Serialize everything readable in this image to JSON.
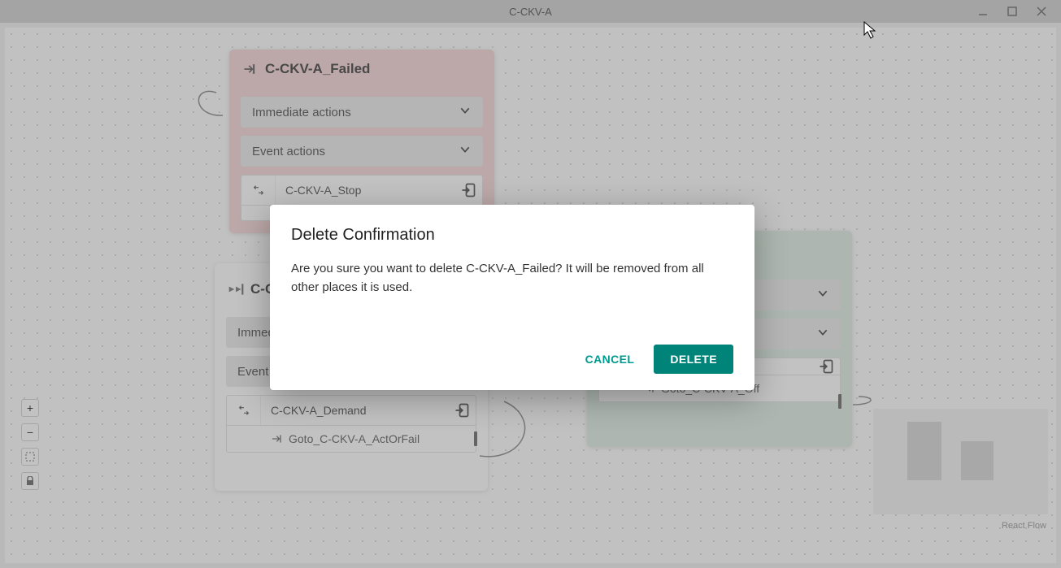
{
  "window": {
    "title": "C-CKV-A"
  },
  "modal": {
    "title": "Delete Confirmation",
    "body": "Are you sure you want to delete C-CKV-A_Failed? It will be removed from all other places it is used.",
    "cancel": "CANCEL",
    "delete": "DELETE"
  },
  "labels": {
    "immediate": "Immediate actions",
    "event": "Event actions"
  },
  "nodes": {
    "failed": {
      "title": "C-CKV-A_Failed",
      "stop": "C-CKV-A_Stop",
      "goto_off_partial": "Goto_C-CKV-A_Off"
    },
    "standby": {
      "title": "C-CKV",
      "demand": "C-CKV-A_Demand",
      "goto_actorfail": "Goto_C-CKV-A_ActOrFail"
    },
    "off": {
      "goto_off": "Goto_C-CKV-A_Off"
    }
  },
  "attribution": "React Flow"
}
